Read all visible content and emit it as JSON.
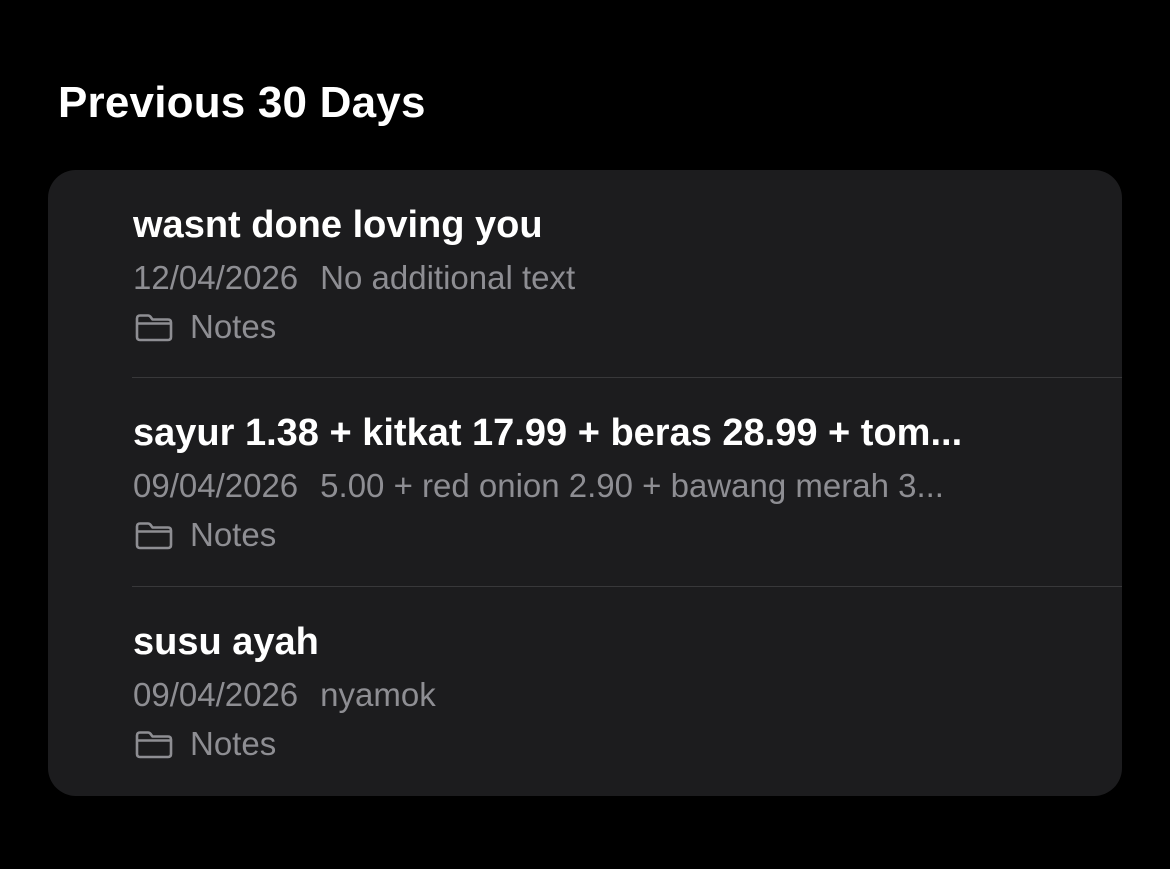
{
  "section": {
    "title": "Previous 30 Days"
  },
  "notes": [
    {
      "title": "wasnt done loving you",
      "date": "12/04/2026",
      "preview": "No additional text",
      "folder": "Notes",
      "folder_icon": "folder-icon"
    },
    {
      "title": "sayur 1.38 + kitkat 17.99 + beras 28.99 + tom...",
      "date": "09/04/2026",
      "preview": "5.00 + red onion 2.90 + bawang merah 3...",
      "folder": "Notes",
      "folder_icon": "folder-icon"
    },
    {
      "title": "susu ayah",
      "date": "09/04/2026",
      "preview": "nyamok",
      "folder": "Notes",
      "folder_icon": "folder-icon"
    }
  ],
  "colors": {
    "background": "#000000",
    "card": "#1c1c1e",
    "primary_text": "#ffffff",
    "secondary_text": "#8e8e93",
    "separator": "#38383a"
  }
}
